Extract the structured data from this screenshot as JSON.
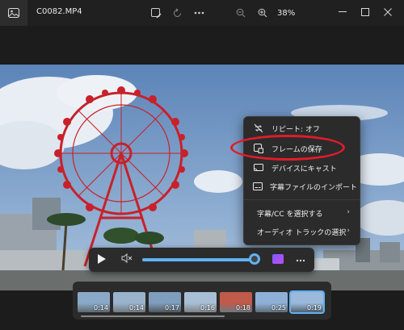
{
  "window": {
    "title": "C0082.MP4",
    "zoom_level": "38%",
    "icons": {
      "app": "photos-app-icon",
      "edit": "edit-image-icon",
      "rotate": "rotate-icon",
      "more": "more-icon",
      "zoom_out": "zoom-out-icon",
      "zoom_in": "zoom-in-icon",
      "minimize": "minimize-icon",
      "maximize": "maximize-icon",
      "close": "close-icon"
    }
  },
  "context_menu": {
    "items": [
      {
        "label": "リピート: オフ",
        "icon": "repeat-off-icon"
      },
      {
        "label": "フレームの保存",
        "icon": "save-frame-icon"
      },
      {
        "label": "デバイスにキャスト",
        "icon": "cast-icon"
      },
      {
        "label": "字幕ファイルのインポート",
        "icon": "subtitle-import-icon"
      },
      {
        "label": "字幕/CC を選択する",
        "chevron": "›"
      },
      {
        "label": "オーディオ トラックの選択",
        "chevron": "›"
      }
    ]
  },
  "player": {
    "progress_fraction": 0.95,
    "icons": {
      "play": "play-icon",
      "mute": "mute-icon",
      "clip": "clipchamp-icon",
      "more": "more-icon"
    }
  },
  "filmstrip": {
    "thumbnails": [
      {
        "duration": "0:14",
        "colors": [
          "#8aa9c9",
          "#5b6a70"
        ]
      },
      {
        "duration": "0:14",
        "colors": [
          "#9ab3cc",
          "#6e7b80"
        ]
      },
      {
        "duration": "0:17",
        "colors": [
          "#7f9dbd",
          "#4f5a5e"
        ]
      },
      {
        "duration": "0:16",
        "colors": [
          "#a7bed4",
          "#7b8488"
        ]
      },
      {
        "duration": "0:18",
        "colors": [
          "#c05a4a",
          "#6b7a82"
        ]
      },
      {
        "duration": "0:25",
        "colors": [
          "#8fb0d6",
          "#5e6f7a"
        ]
      },
      {
        "duration": "0:19",
        "colors": [
          "#9bb9da",
          "#4f6170"
        ],
        "selected": true
      }
    ]
  },
  "colors": {
    "accent": "#5fb2f2",
    "annotation_circle": "#e01c2a",
    "ferris_wheel_red": "#c8212a"
  }
}
